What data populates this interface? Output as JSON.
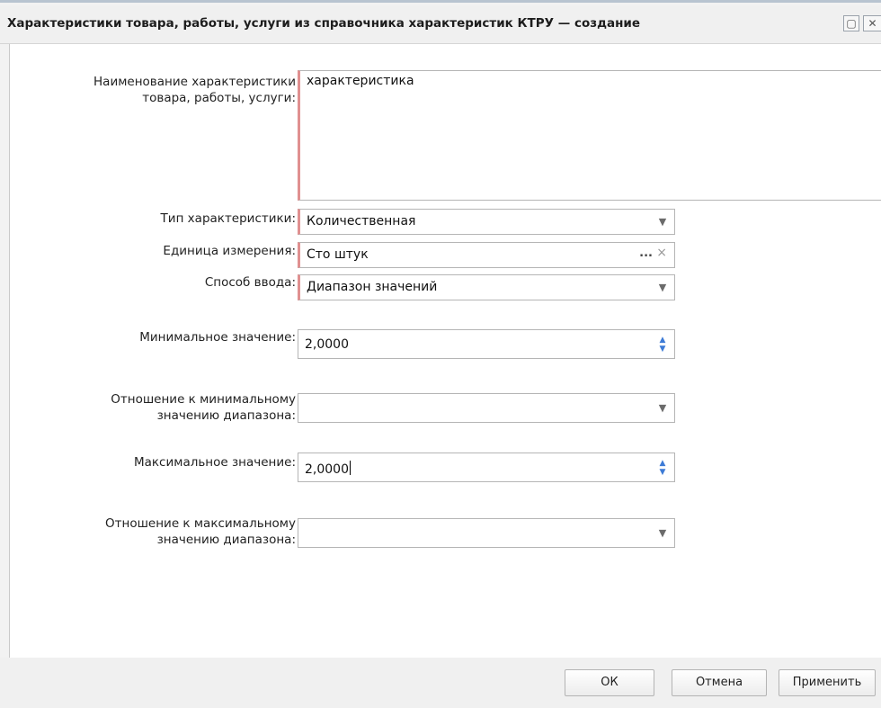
{
  "window": {
    "title": "Характеристики товара, работы, услуги из справочника характеристик КТРУ — создание",
    "restore_icon": "restore-icon",
    "close_icon": "close-icon"
  },
  "form": {
    "name_label_line1": "Наименование характеристики",
    "name_label_line2": "товара, работы, услуги:",
    "name_value": "характеристика",
    "type_label": "Тип характеристики:",
    "type_value": "Количественная",
    "unit_label": "Единица измерения:",
    "unit_value": "Сто штук",
    "unit_pick": "...",
    "unit_clear": "×",
    "input_method_label": "Способ ввода:",
    "input_method_value": "Диапазон значений",
    "min_label": "Минимальное значение:",
    "min_value": "2,0000",
    "min_relation_label_line1": "Отношение к минимальному",
    "min_relation_label_line2": "значению диапазона:",
    "min_relation_value": "",
    "max_label": "Максимальное значение:",
    "max_value": "2,0000",
    "max_relation_label_line1": "Отношение к максимальному",
    "max_relation_label_line2": "значению диапазона:",
    "max_relation_value": ""
  },
  "footer": {
    "ok_label": "ОК",
    "cancel_label": "Отмена",
    "apply_label": "Применить"
  },
  "colors": {
    "required_marker": "#e09090",
    "spinner_accent": "#3d7bd6"
  }
}
